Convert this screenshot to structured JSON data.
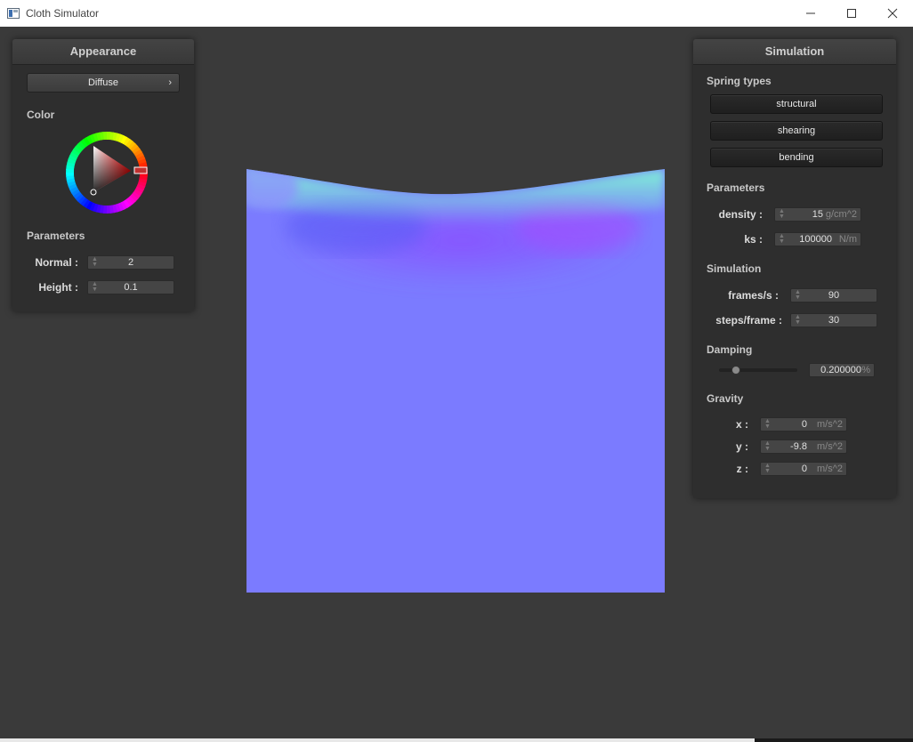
{
  "window": {
    "title": "Cloth Simulator",
    "controls": [
      "minimize",
      "maximize",
      "close"
    ]
  },
  "cloth": {
    "base_color": "#7b7bff",
    "highlight_colors": [
      "#7dffd8",
      "#9a4cff"
    ]
  },
  "appearance_panel": {
    "title": "Appearance",
    "shader_select": "Diffuse",
    "color_label": "Color",
    "params_label": "Parameters",
    "normal_label": "Normal :",
    "normal_value": "2",
    "height_label": "Height :",
    "height_value": "0.1"
  },
  "simulation_panel": {
    "title": "Simulation",
    "spring_types_label": "Spring types",
    "spring_buttons": [
      "structural",
      "shearing",
      "bending"
    ],
    "params_label": "Parameters",
    "density_label": "density :",
    "density_value": "15",
    "density_unit": "g/cm^2",
    "ks_label": "ks :",
    "ks_value": "100000",
    "ks_unit": "N/m",
    "sim_label": "Simulation",
    "fps_label": "frames/s :",
    "fps_value": "90",
    "steps_label": "steps/frame :",
    "steps_value": "30",
    "damping_label": "Damping",
    "damping_value": "0.200000",
    "damping_unit": "%",
    "damping_slider_fraction": 0.2,
    "gravity_label": "Gravity",
    "gx_label": "x :",
    "gx_value": "0",
    "gy_label": "y :",
    "gy_value": "-9.8",
    "gz_label": "z :",
    "gz_value": "0",
    "gravity_unit": "m/s^2"
  }
}
